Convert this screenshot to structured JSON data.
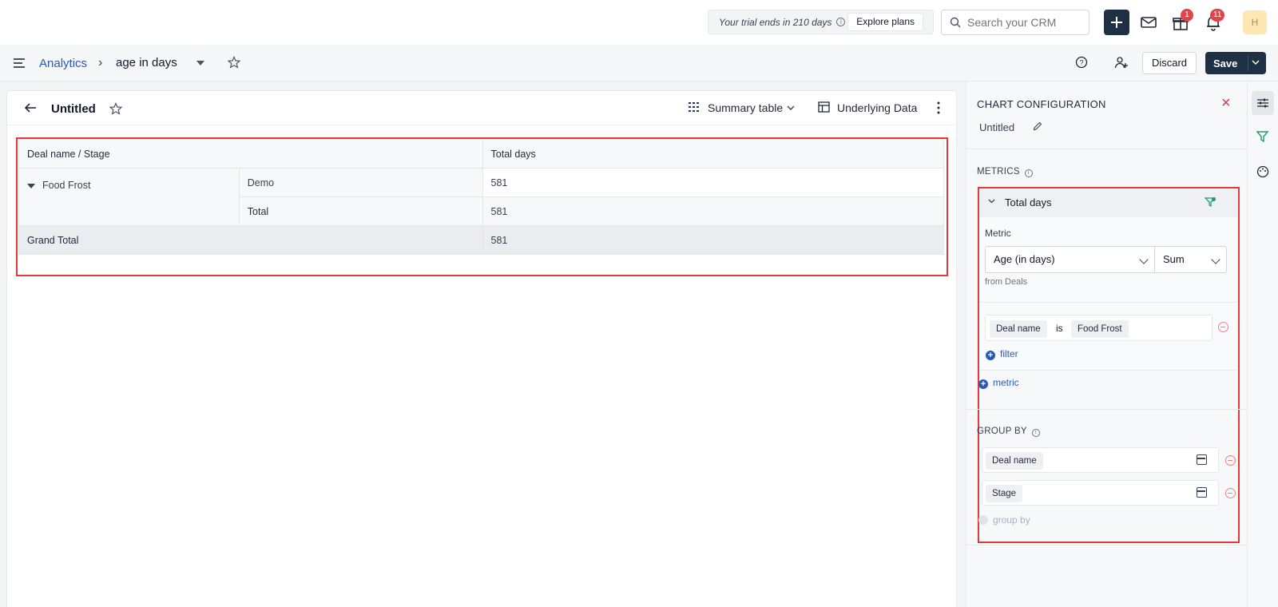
{
  "topbar": {
    "trial_text": "Your trial ends in 210 days",
    "explore_plans": "Explore plans",
    "search_placeholder": "Search your CRM",
    "gift_badge": "1",
    "notif_badge": "11",
    "avatar_initial": "H"
  },
  "subbar": {
    "breadcrumb_root": "Analytics",
    "breadcrumb_sep": "›",
    "report_name": "age in days",
    "discard": "Discard",
    "save": "Save"
  },
  "card": {
    "title": "Untitled",
    "summary_table": "Summary table",
    "underlying_data": "Underlying Data"
  },
  "table": {
    "col1": "Deal name / Stage",
    "col2": "Total days",
    "deal": "Food Frost",
    "stage": "Demo",
    "stage_value": "581",
    "total_label": "Total",
    "total_value": "581",
    "grand_label": "Grand Total",
    "grand_value": "581"
  },
  "panel": {
    "title": "CHART CONFIGURATION",
    "chart_name": "Untitled",
    "metrics_label": "METRICS",
    "metric_name": "Total days",
    "metric_field_label": "Metric",
    "metric_field": "Age (in days)",
    "aggregation": "Sum",
    "from_text": "from Deals",
    "filter_field": "Deal name",
    "filter_op": "is",
    "filter_value": "Food Frost",
    "add_filter": "filter",
    "add_metric": "metric",
    "groupby_label": "GROUP BY",
    "groupby_1": "Deal name",
    "groupby_2": "Stage",
    "add_groupby": "group by"
  },
  "colors": {
    "primary_dark": "#1e3044",
    "link_blue": "#2a5ab9",
    "highlight_red": "#e23a3a",
    "badge_red": "#e0454a"
  }
}
